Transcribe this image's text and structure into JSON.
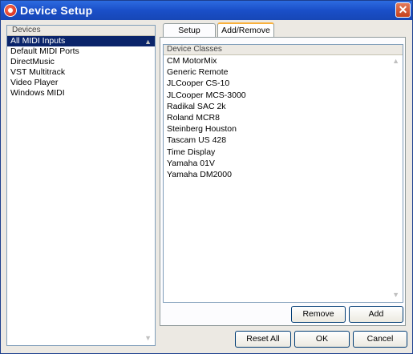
{
  "window": {
    "title": "Device Setup",
    "close_glyph": "✕"
  },
  "devices": {
    "header": "Devices",
    "items": [
      {
        "label": "All MIDI Inputs",
        "selected": true
      },
      {
        "label": "Default MIDI Ports"
      },
      {
        "label": "DirectMusic"
      },
      {
        "label": "VST Multitrack"
      },
      {
        "label": "Video Player"
      },
      {
        "label": "Windows MIDI"
      }
    ]
  },
  "tabs": [
    {
      "label": "Setup",
      "active": false
    },
    {
      "label": "Add/Remove",
      "active": true
    }
  ],
  "device_classes": {
    "header": "Device Classes",
    "items": [
      "CM MotorMix",
      "Generic Remote",
      "JLCooper CS-10",
      "JLCooper MCS-3000",
      "Radikal SAC 2k",
      "Roland MCR8",
      "Steinberg Houston",
      "Tascam US 428",
      "Time Display",
      "Yamaha 01V",
      "Yamaha DM2000"
    ]
  },
  "buttons": {
    "remove": "Remove",
    "add": "Add",
    "reset_all": "Reset All",
    "ok": "OK",
    "cancel": "Cancel"
  },
  "icons": {
    "scroll_up": "▲",
    "scroll_down": "▼"
  },
  "colors": {
    "title_bar": "#1a4fc8",
    "selection": "#0a246a",
    "active_tab_accent": "#f9b13c"
  }
}
